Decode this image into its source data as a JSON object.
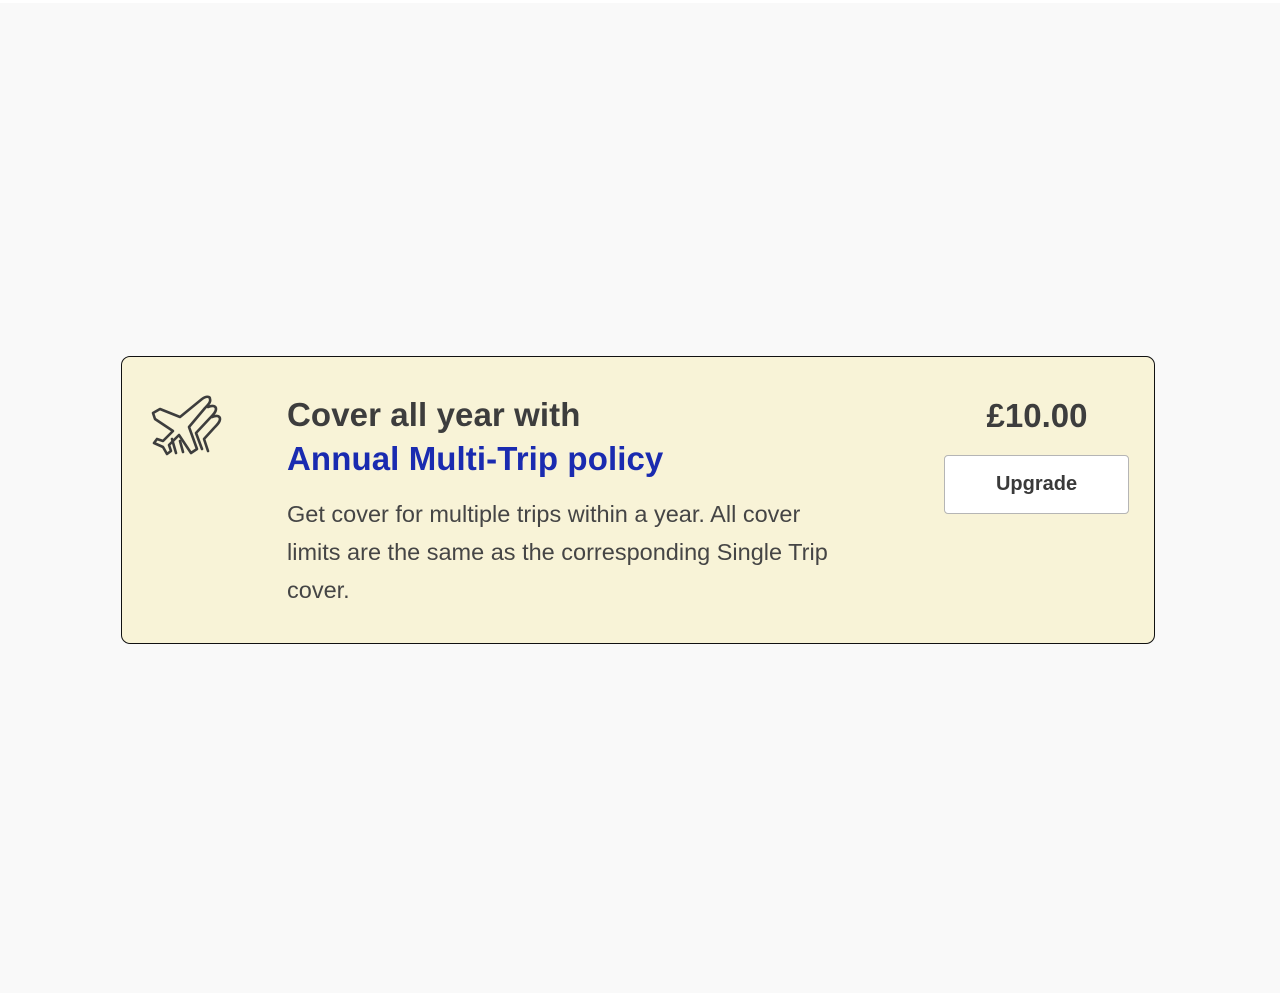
{
  "card": {
    "icon": "airplane-icon",
    "heading_lead": "Cover all year with",
    "heading_accent": "Annual Multi-Trip policy",
    "description": "Get cover for multiple trips within a year. All cover limits are the same as the corresponding Single Trip cover.",
    "price": "£10.00",
    "upgrade_label": "Upgrade"
  },
  "colors": {
    "page_background": "#f9f9f9",
    "card_background": "#f8f3d7",
    "card_border": "#111111",
    "accent": "#1a2bb0",
    "text": "#3d3d3d"
  }
}
